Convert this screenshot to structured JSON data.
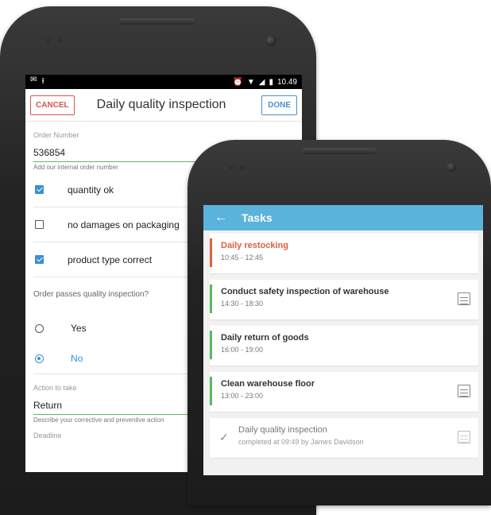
{
  "statusbar": {
    "time": "10.49"
  },
  "inspection": {
    "cancel_label": "CANCEL",
    "title": "Daily quality inspection",
    "done_label": "DONE",
    "order_number_label": "Order Number",
    "order_number_value": "536854",
    "order_number_help": "Add our internal order number",
    "checks": [
      {
        "label": "quantity ok",
        "checked": true
      },
      {
        "label": "no damages on packaging",
        "checked": false
      },
      {
        "label": "product type correct",
        "checked": true
      }
    ],
    "question": "Order passes quality inspection?",
    "options": [
      {
        "label": "Yes",
        "selected": false
      },
      {
        "label": "No",
        "selected": true
      }
    ],
    "action_label": "Action to take",
    "action_value": "Return",
    "action_help": "Describe your corrective and preventive action",
    "deadline_label": "Deadline"
  },
  "tasks": {
    "title": "Tasks",
    "items": [
      {
        "title": "Daily restocking",
        "time": "10:45 - 12:45",
        "color": "#e0603a"
      },
      {
        "title": "Conduct safety inspection of warehouse",
        "time": "14:30 - 18:30",
        "color": "#5cb85c"
      },
      {
        "title": "Daily return of goods",
        "time": "16:00 - 19:00",
        "color": "#5cb85c"
      },
      {
        "title": "Clean warehouse floor",
        "time": "13:00 - 23:00",
        "color": "#5cb85c"
      },
      {
        "title": "Daily quality inspection",
        "time": "completed at 09:49 by James Davidson"
      }
    ]
  },
  "colors": {
    "accent": "#3a8fd6",
    "tasks_bar": "#5ab3db",
    "cancel": "#d9534f",
    "field_line": "#5cb85c"
  }
}
